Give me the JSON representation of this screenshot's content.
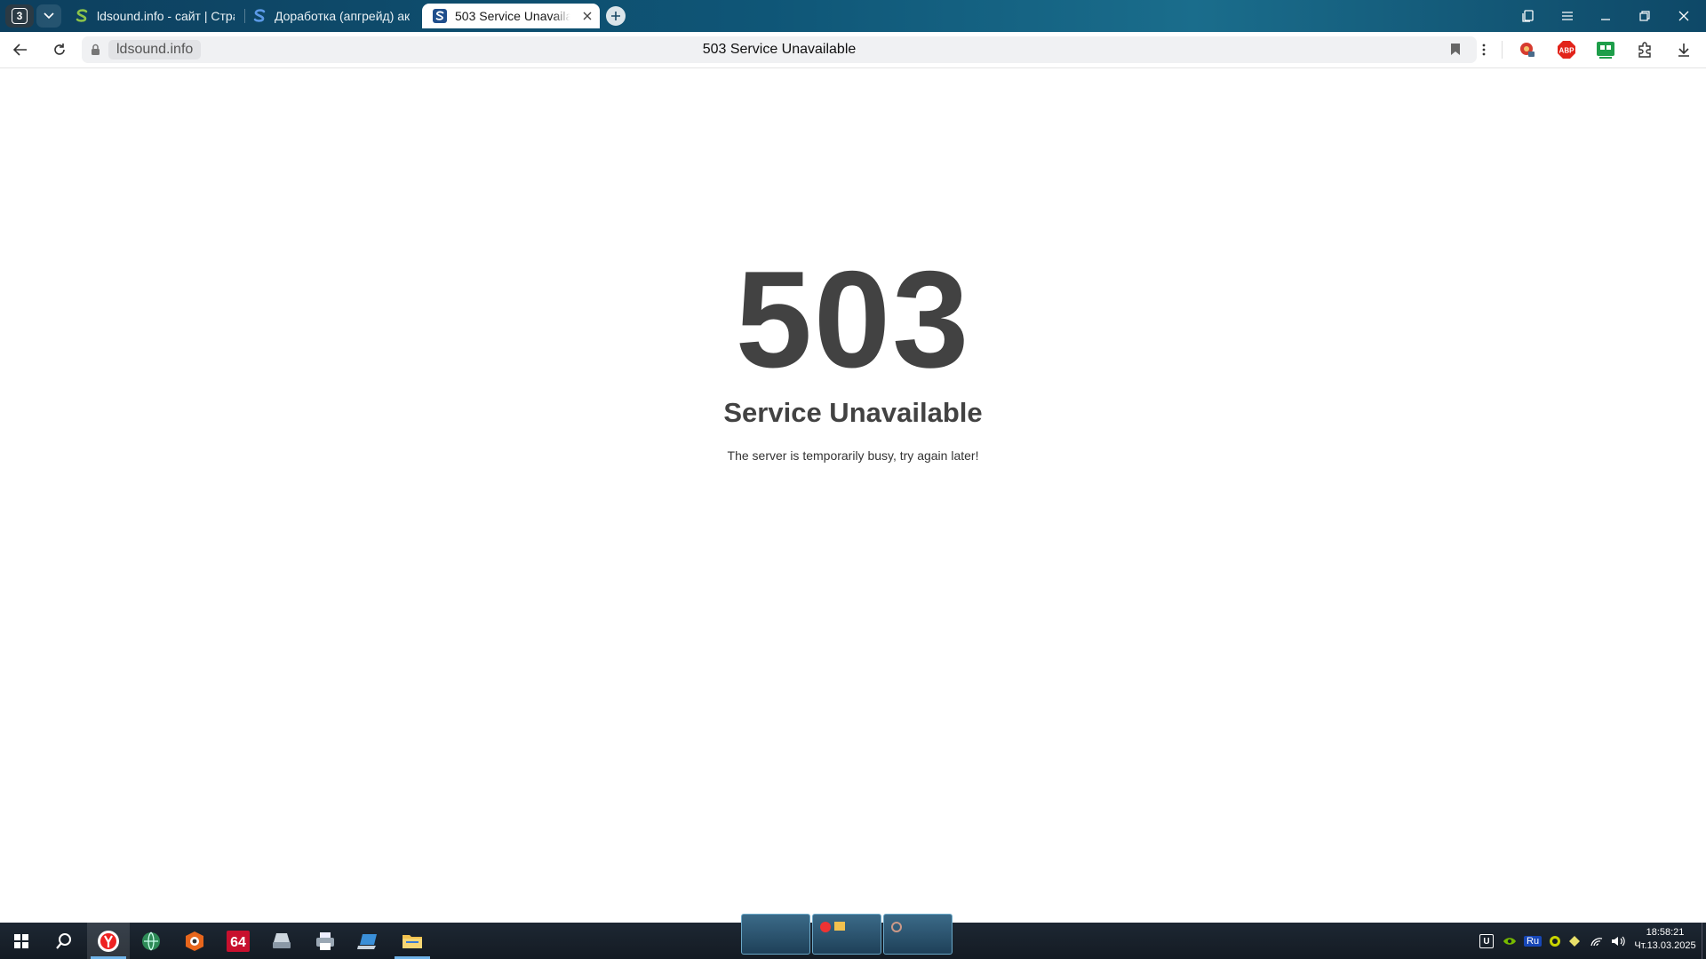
{
  "browser": {
    "tab_count": "3",
    "tabs": [
      {
        "title": "ldsound.info - сайт | Стра",
        "active": false
      },
      {
        "title": "Доработка (апгрейд) ак",
        "active": false
      },
      {
        "title": "503 Service Unavailable",
        "active": true
      }
    ],
    "address": {
      "host": "ldsound.info",
      "page_title": "503 Service Unavailable"
    }
  },
  "page": {
    "code": "503",
    "title": "Service Unavailable",
    "message": "The server is temporarily busy, try again later!"
  },
  "taskbar": {
    "tray": {
      "language": "Ru"
    },
    "clock": {
      "time": "18:58:21",
      "date": "Чт.13.03.2025"
    }
  },
  "colors": {
    "text_dark": "#424242",
    "tab_strip": "#0f5677",
    "taskbar_indicator": "#6fb3e8"
  }
}
